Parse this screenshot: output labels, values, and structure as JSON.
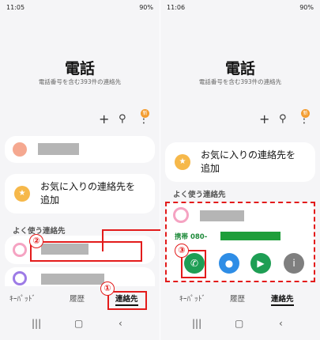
{
  "left": {
    "status": {
      "time": "11:05",
      "right": "90%"
    },
    "title": "電話",
    "subtitle": "電話番号を含む393件の連絡先",
    "badge": "新",
    "favorites_text_line1": "お気に入りの連絡先を",
    "favorites_text_line2": "追加",
    "section": "よく使う連絡先",
    "tabs": [
      "ｷｰﾊﾟｯﾄﾞ",
      "履歴",
      "連絡先"
    ],
    "markers": [
      "①",
      "②"
    ]
  },
  "right": {
    "status": {
      "time": "11:06",
      "right": "90%"
    },
    "title": "電話",
    "subtitle": "電話番号を含む393件の連絡先",
    "badge": "新",
    "favorites_text_line1": "お気に入りの連絡先を",
    "favorites_text_line2": "追加",
    "section": "よく使う連絡先",
    "phone_label": "携帯 080-",
    "tabs": [
      "ｷｰﾊﾟｯﾄﾞ",
      "履歴",
      "連絡先"
    ],
    "markers": [
      "③"
    ]
  },
  "nav_icons": [
    "menu-icon",
    "home-icon",
    "back-icon"
  ],
  "colors": {
    "accent_orange": "#f6b84a",
    "red": "#e31b1b",
    "call_green": "#1e9e54",
    "msg_blue": "#2e8de6",
    "info_gray": "#7f7f7f"
  }
}
